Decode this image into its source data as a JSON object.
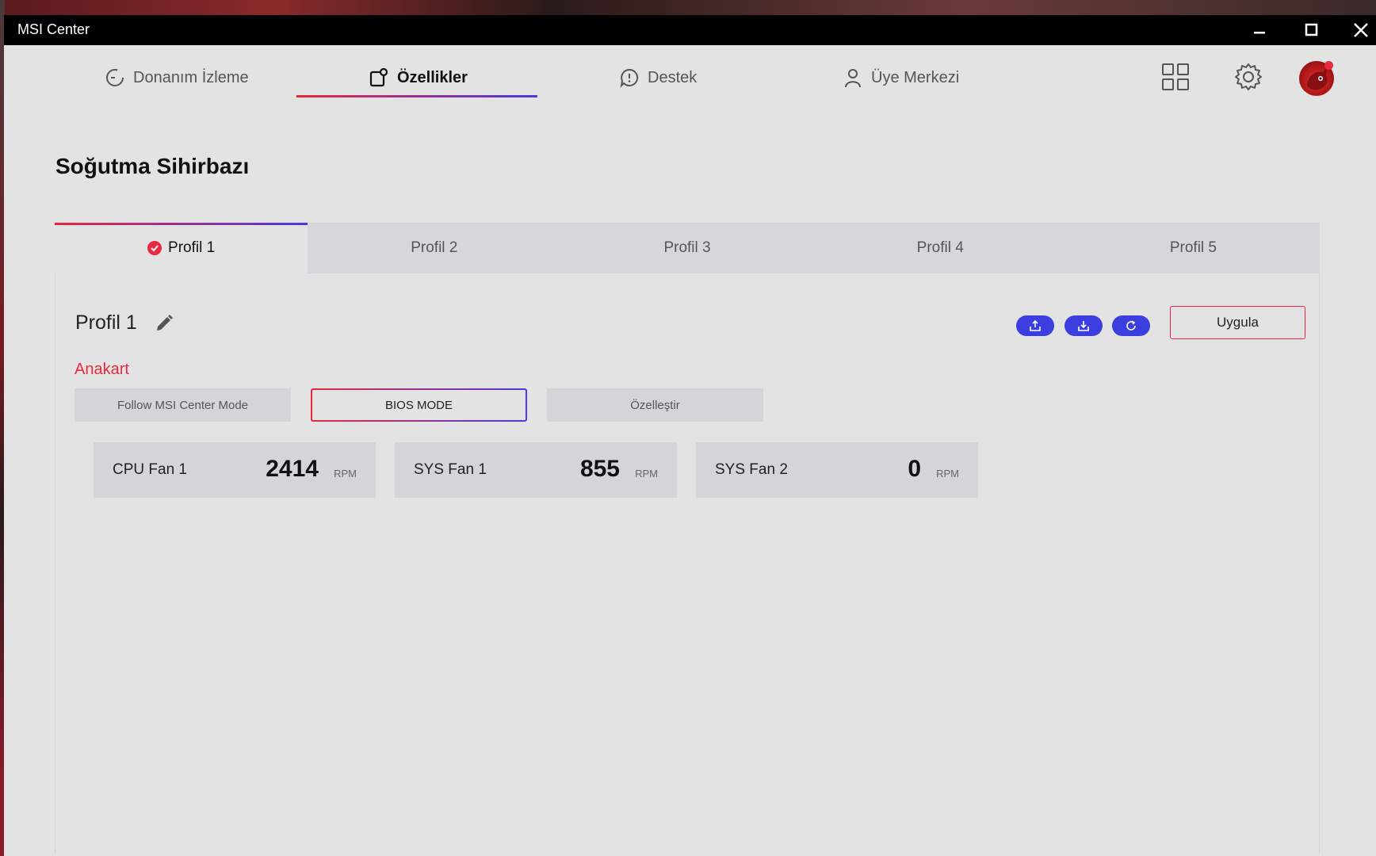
{
  "window": {
    "title": "MSI Center"
  },
  "nav": {
    "items": [
      {
        "label": "Donanım İzleme",
        "icon": "gauge-icon"
      },
      {
        "label": "Özellikler",
        "icon": "features-icon",
        "active": true
      },
      {
        "label": "Destek",
        "icon": "chat-support-icon"
      },
      {
        "label": "Üye Merkezi",
        "icon": "user-icon"
      }
    ]
  },
  "page": {
    "title": "Soğutma Sihirbazı"
  },
  "tabs": [
    {
      "label": "Profil 1",
      "active": true
    },
    {
      "label": "Profil 2"
    },
    {
      "label": "Profil 3"
    },
    {
      "label": "Profil 4"
    },
    {
      "label": "Profil 5"
    }
  ],
  "profile": {
    "name": "Profil 1",
    "apply_label": "Uygula"
  },
  "section": {
    "label": "Anakart"
  },
  "modes": [
    {
      "label": "Follow MSI Center Mode"
    },
    {
      "label": "BIOS MODE",
      "selected": true
    },
    {
      "label": "Özelleştir"
    }
  ],
  "fans": [
    {
      "name": "CPU Fan 1",
      "value": "2414",
      "unit": "RPM"
    },
    {
      "name": "SYS Fan 1",
      "value": "855",
      "unit": "RPM"
    },
    {
      "name": "SYS Fan 2",
      "value": "0",
      "unit": "RPM"
    }
  ],
  "colors": {
    "accent_red": "#e8293f",
    "accent_blue": "#3c3ee0"
  }
}
